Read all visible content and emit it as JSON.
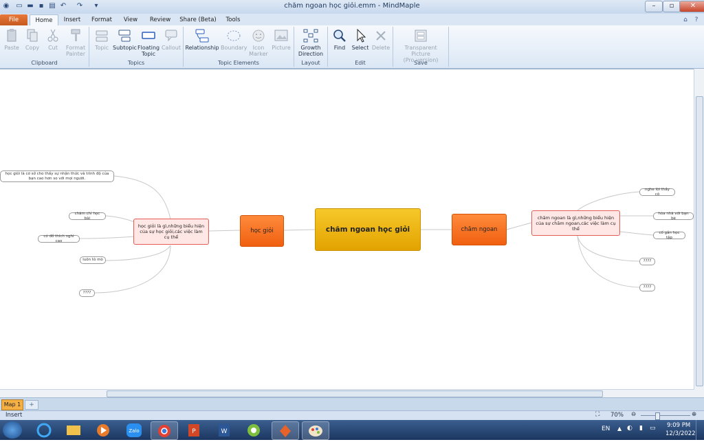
{
  "window": {
    "title": "chăm ngoan học giỏi.emm - MindMaple",
    "buttons": {
      "minimize": "–",
      "maximize": "▫",
      "close": "✕"
    }
  },
  "tabs": [
    "File",
    "Home",
    "Insert",
    "Format",
    "View",
    "Review",
    "Share (Beta)",
    "Tools"
  ],
  "ribbon": {
    "groups": {
      "clipboard": "Clipboard",
      "topics": "Topics",
      "topic_elements": "Topic Elements",
      "layout": "Layout",
      "edit": "Edit",
      "save": "Save"
    },
    "buttons": {
      "paste": "Paste",
      "copy": "Copy",
      "cut": "Cut",
      "format_painter_1": "Format",
      "format_painter_2": "Painter",
      "topic": "Topic",
      "subtopic": "Subtopic",
      "floating_topic_1": "Floating",
      "floating_topic_2": "Topic",
      "callout": "Callout",
      "relationship": "Relationship",
      "boundary": "Boundary",
      "icon_marker_1": "Icon",
      "icon_marker_2": "Marker",
      "picture": "Picture",
      "growth_direction_1": "Growth",
      "growth_direction_2": "Direction",
      "find": "Find",
      "select": "Select",
      "delete": "Delete",
      "transparent_picture_1": "Transparent Picture",
      "transparent_picture_2": "(Pro version)"
    }
  },
  "mindmap": {
    "central": "chăm ngoan học giỏi",
    "left_main": "học giỏi",
    "right_main": "chăm ngoan",
    "left_sub": "học giỏi là gì,những biểu hiện của sự học giỏi,các việc làm cụ thể",
    "right_sub": "chăm ngoan là gì,những biểu hiện của sự chăm ngoan,các việc làm cụ thể",
    "left_leaves": [
      "học giỏi là cơ sở cho thấy sự nhận thức và trình độ của bạn cao hơn so với mọi người.",
      "chăm chỉ học bài",
      "có đồ thích nghi cao",
      "luôn tò mò",
      "????"
    ],
    "right_leaves": [
      "nghe lời thầy cô",
      "hòa nhã với bạn bè",
      "cố gắn học tập",
      "????",
      "????"
    ]
  },
  "map_tab": "Map 1",
  "status": {
    "mode": "Insert",
    "zoom": "70%"
  },
  "taskbar": {
    "lang": "EN",
    "time": "9:09 PM",
    "date": "12/3/2022"
  }
}
